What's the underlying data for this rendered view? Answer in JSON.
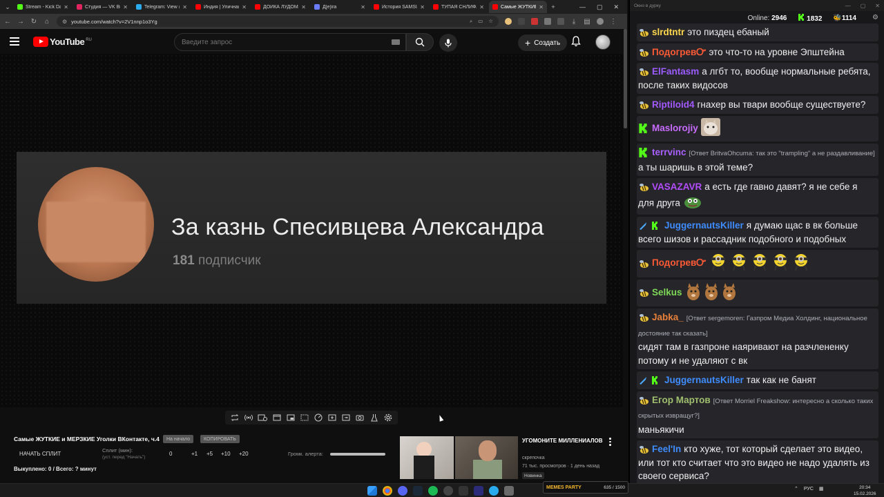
{
  "browser": {
    "tabs": [
      {
        "title": "Stream - Kick Dashb",
        "fav_color": "#53fc18"
      },
      {
        "title": "Студия — VK Видео",
        "fav_color": "#e0245e"
      },
      {
        "title": "Telegram: View @s",
        "fav_color": "#2aabee"
      },
      {
        "title": "Индия | Уличная е",
        "fav_color": "#ff0000"
      },
      {
        "title": "ДОЙКА ЛУДОМАНОВ",
        "fav_color": "#ff0000"
      },
      {
        "title": "Д[е]ira",
        "fav_color": "#6b7cff"
      },
      {
        "title": "История SAMSUNG",
        "fav_color": "#ff0000"
      },
      {
        "title": "ТУПАЯ СНЛИФАНКА",
        "fav_color": "#ff0000"
      },
      {
        "title": "Самые ЖУТКИЕ",
        "fav_color": "#ff0000",
        "active": true
      }
    ],
    "url": "youtube.com/watch?v=2V1nnp1o3Yg"
  },
  "youtube": {
    "logo_text": "YouTube",
    "country": "RU",
    "search_placeholder": "Введите запрос",
    "create_label": "Создать"
  },
  "video": {
    "channel_name": "За казнь Спесивцева Александра",
    "subs_count": "181",
    "subs_label": "подписчик"
  },
  "info": {
    "title": "Самые ЖУТКИЕ и МЕРЗКИЕ Уголки ВКонтакте, ч.4",
    "chip_start": "На начало",
    "chip_copy": "КОПИРОВАТЬ",
    "split_start": "НАЧАТЬ СПЛИТ",
    "split_label": "Сплит (мин):",
    "split_hint": "(уст. перед \"Начать\")",
    "split_values": [
      "0",
      "+1",
      "+5",
      "+10",
      "+20"
    ],
    "alert_label": "Громк. алерта:",
    "bought": "Выкуплено: 0 / Всего: ? минут"
  },
  "recommendation": {
    "title": "УГОМОНИТЕ МИЛЛЕНИАЛОВ",
    "channel": "скрепочка",
    "views": "71 тыс. просмотров · 1 день назад",
    "badge": "Новинка"
  },
  "chat": {
    "window_title": "Окно в дурку",
    "online_label": "Online:",
    "online_count": "2946",
    "kick_count": "1832",
    "other_count": "1114",
    "messages": [
      {
        "user": "slrdtntr",
        "color": "#ffd84d",
        "badge": "bee",
        "reply": "",
        "text": "это пиздец ебаный",
        "emotes": []
      },
      {
        "user": "ПодогревᏅ",
        "color": "#ff5a36",
        "badge": "bee",
        "reply": "",
        "text": "это что-то на уровне Эпштейна",
        "emotes": []
      },
      {
        "user": "ElFantasm",
        "color": "#9b5cff",
        "badge": "bee",
        "reply": "",
        "text": "а лгбт то, вообще нормальные ребята, после таких видосов",
        "emotes": []
      },
      {
        "user": "Riptiloid4",
        "color": "#a259ff",
        "badge": "bee",
        "reply": "",
        "text": "гнахер вы твари вообще существуете?",
        "emotes": []
      },
      {
        "user": "Maslorojiy",
        "color": "#c86bff",
        "badge": "kick",
        "reply": "",
        "text": "",
        "emotes": [
          "cat"
        ]
      },
      {
        "user": "terrvinc",
        "color": "#a960ff",
        "badge": "kick",
        "reply": "[Ответ BritvaOhcuma: так это \"trampling\" а не раздавливание]",
        "text": "а ты шаришь в этой теме?",
        "emotes": []
      },
      {
        "user": "VASAZAVR",
        "color": "#b44cff",
        "badge": "bee",
        "reply": "",
        "text": "а есть где гавно давят? я не себе я для друга",
        "emotes": [
          "pepe"
        ]
      },
      {
        "user": "JuggernautsKiller",
        "color": "#3f8cff",
        "badge": "kick2",
        "reply": "",
        "text": "я думаю щас в вк больше всего шизов и рассадник подобного и подобных",
        "emotes": []
      },
      {
        "user": "ПодогревᏅ",
        "color": "#ff5a36",
        "badge": "bee",
        "reply": "",
        "text": "",
        "emotes": [
          "minion",
          "minion",
          "minion",
          "minion",
          "minion"
        ]
      },
      {
        "user": "Selkus",
        "color": "#7ed957",
        "badge": "bee",
        "reply": "",
        "text": "",
        "emotes": [
          "cat2",
          "cat2",
          "cat2"
        ]
      },
      {
        "user": "Jabka_",
        "color": "#e8803a",
        "badge": "bee",
        "reply": "[Ответ sergemoren: Газпром Медиа Холдинг, национальное достояние так сказать]",
        "text": "сидят там в газпроне наяривают на разчлененку потому и не удаляют с вк",
        "emotes": []
      },
      {
        "user": "JuggernautsKiller",
        "color": "#3f8cff",
        "badge": "kick2",
        "reply": "",
        "text": "так как не банят",
        "emotes": []
      },
      {
        "user": "Егор Мартов",
        "color": "#9fbf6f",
        "badge": "bee",
        "reply": "[Ответ Morriel Freakshow: интересно а сколько таких скрытых извращуг?]",
        "text": "маньякичи",
        "emotes": []
      },
      {
        "user": "Feel'In",
        "color": "#3f8cff",
        "badge": "bee",
        "reply": "",
        "text": "кто хуже, тот который сделает это видео, или тот кто считает что это видео не надо удалять из своего сервиса?",
        "emotes": []
      }
    ]
  },
  "taskbar": {
    "meme_label": "MEMES PARTY",
    "meme_count": "635 / 1500",
    "lang": "РУС",
    "time": "20:34",
    "date": "15.02.2026"
  }
}
